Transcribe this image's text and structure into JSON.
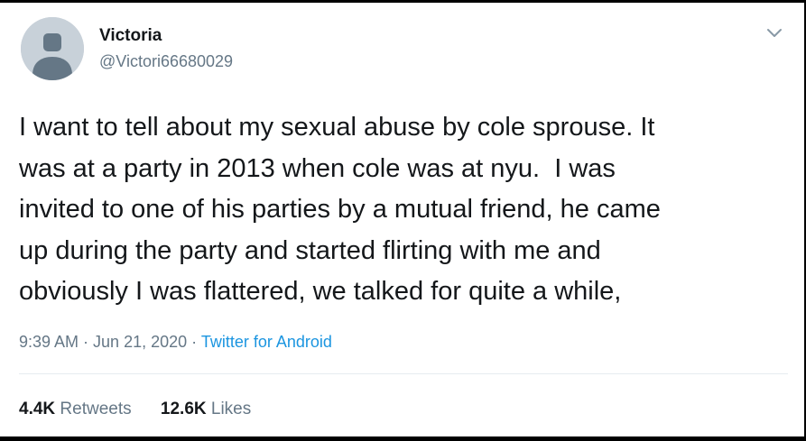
{
  "user": {
    "display_name": "Victoria",
    "handle": "@Victori66680029",
    "avatar_icon": "default-profile-icon"
  },
  "tweet": {
    "lines": [
      "I want to tell about my sexual abuse by cole sprouse. It",
      "was at a party in 2013 when cole was at nyu.  I was",
      "invited to one of his parties by a mutual friend, he came",
      "up during the party and started flirting with me and",
      "obviously I was flattered, we talked for quite a while,"
    ],
    "time": "9:39 AM",
    "date": "Jun 21, 2020",
    "separator": " · ",
    "source": "Twitter for Android"
  },
  "stats": {
    "retweets_count": "4.4K",
    "retweets_label": "Retweets",
    "likes_count": "12.6K",
    "likes_label": "Likes"
  },
  "colors": {
    "text": "#14171a",
    "secondary": "#657786",
    "link": "#1b95e0",
    "divider": "#e6ecf0",
    "avatar_bg": "#c8d1d9",
    "avatar_figure": "#657786"
  }
}
